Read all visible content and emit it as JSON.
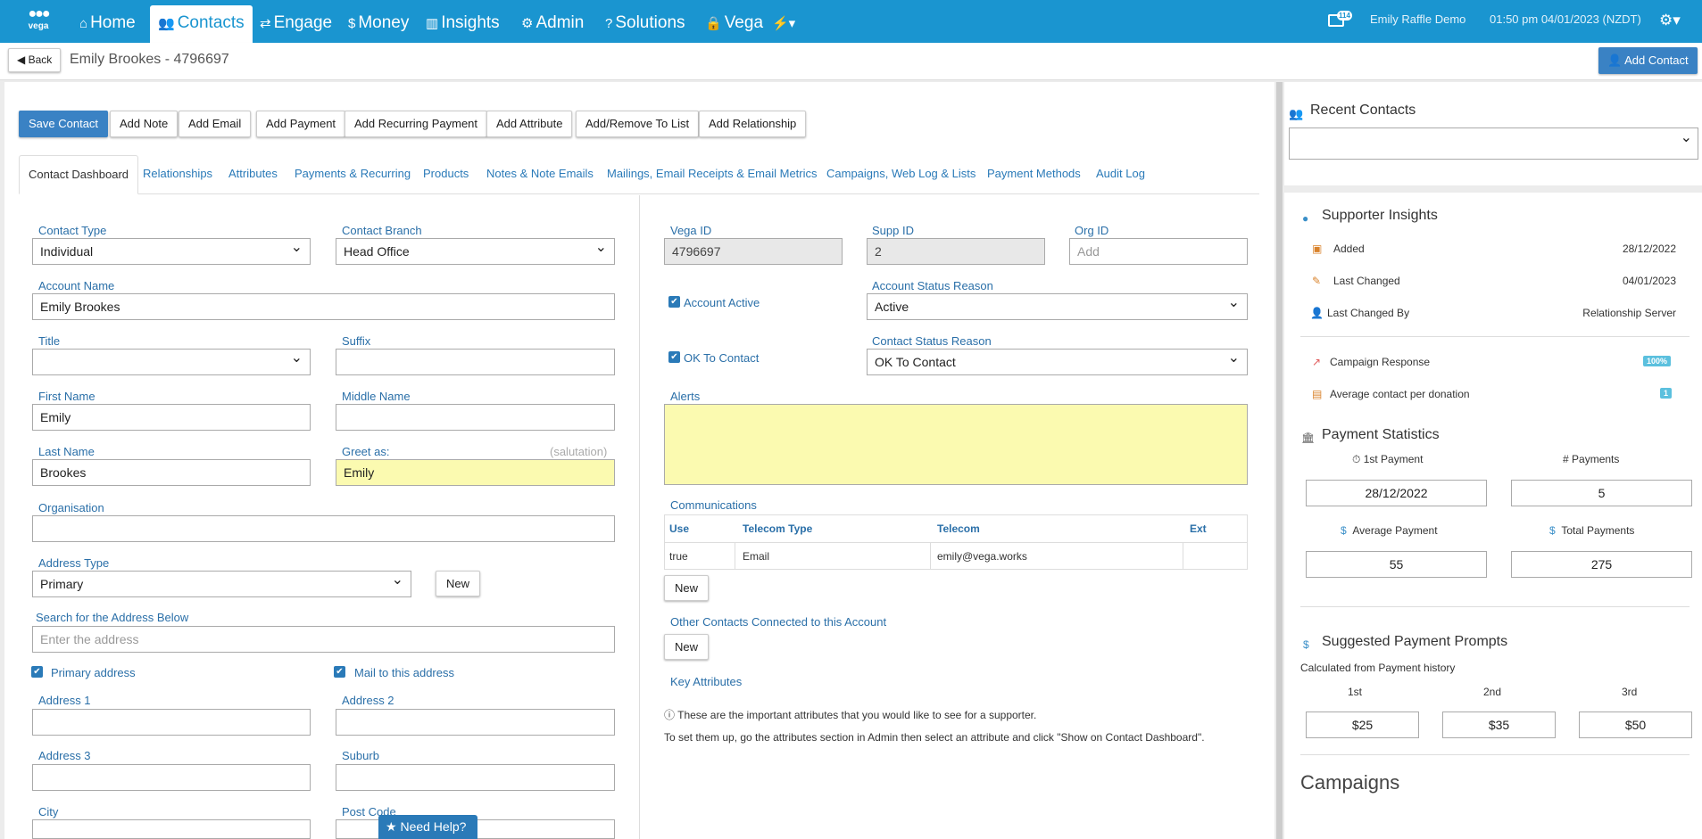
{
  "nav": {
    "logo_text": "vega",
    "items": [
      {
        "icon": "⌂",
        "label": "Home"
      },
      {
        "icon": "👥",
        "label": "Contacts"
      },
      {
        "icon": "⇄",
        "label": "Engage"
      },
      {
        "icon": "$",
        "label": "Money"
      },
      {
        "icon": "▥",
        "label": "Insights"
      },
      {
        "icon": "⚙",
        "label": "Admin"
      },
      {
        "icon": "?",
        "label": "Solutions"
      },
      {
        "icon": "🔒",
        "label": "Vega"
      },
      {
        "icon": "⚡▾",
        "label": ""
      }
    ],
    "mail_count": "114",
    "user_name": "Emily Raffle Demo",
    "datetime": "01:50 pm 04/01/2023 (NZDT)",
    "gear_menu": "⚙▾"
  },
  "subheader": {
    "back_label": "Back",
    "title": "Emily Brookes - 4796697",
    "add_contact_label": "Add Contact"
  },
  "actions": {
    "save": "Save Contact",
    "add_note": "Add Note",
    "add_email": "Add Email",
    "add_payment": "Add Payment",
    "add_recurring": "Add Recurring Payment",
    "add_attribute": "Add Attribute",
    "add_remove_list": "Add/Remove To List",
    "add_relationship": "Add Relationship"
  },
  "tabs": [
    "Contact Dashboard",
    "Relationships",
    "Attributes",
    "Payments & Recurring",
    "Products",
    "Notes & Note Emails",
    "Mailings, Email Receipts & Email Metrics",
    "Campaigns, Web Log & Lists",
    "Payment Methods",
    "Audit Log"
  ],
  "form": {
    "contact_type_label": "Contact Type",
    "contact_type_value": "Individual",
    "contact_branch_label": "Contact Branch",
    "contact_branch_value": "Head Office",
    "account_name_label": "Account Name",
    "account_name_value": "Emily Brookes",
    "title_label": "Title",
    "title_value": "",
    "suffix_label": "Suffix",
    "suffix_value": "",
    "first_name_label": "First Name",
    "first_name_value": "Emily",
    "middle_name_label": "Middle Name",
    "middle_name_value": "",
    "last_name_label": "Last Name",
    "last_name_value": "Brookes",
    "greet_as_label": "Greet as:",
    "greet_as_hint": "(salutation)",
    "greet_as_value": "Emily",
    "organisation_label": "Organisation",
    "organisation_value": "",
    "address_type_label": "Address Type",
    "address_type_value": "Primary",
    "address_new_label": "New",
    "search_address_label": "Search for the Address Below",
    "search_address_placeholder": "Enter the address",
    "primary_address_label": "Primary address",
    "mail_to_label": "Mail to this address",
    "address1_label": "Address 1",
    "address2_label": "Address 2",
    "address3_label": "Address 3",
    "suburb_label": "Suburb",
    "city_label": "City",
    "postcode_label": "Post Code"
  },
  "ids": {
    "vega_id_label": "Vega ID",
    "vega_id_value": "4796697",
    "supp_id_label": "Supp ID",
    "supp_id_value": "2",
    "org_id_label": "Org ID",
    "org_id_placeholder": "Add",
    "account_active_label": "Account Active",
    "account_status_label": "Account Status Reason",
    "account_status_value": "Active",
    "ok_to_contact_label": "OK To Contact",
    "contact_status_label": "Contact Status Reason",
    "contact_status_value": "OK To Contact",
    "alerts_label": "Alerts"
  },
  "communications": {
    "title": "Communications",
    "headers": [
      "Use",
      "Telecom Type",
      "Telecom",
      "Ext"
    ],
    "rows": [
      [
        "true",
        "Email",
        "emily@vega.works",
        ""
      ]
    ],
    "new_label": "New",
    "other_contacts_label": "Other Contacts Connected to this Account",
    "other_new_label": "New",
    "key_attributes_label": "Key Attributes",
    "info_line1": "These are the important attributes that you would like to see for a supporter.",
    "info_line2": "To set them up, go the attributes section in Admin then select an attribute and click \"Show on Contact Dashboard\"."
  },
  "need_help": "Need Help?",
  "right": {
    "recent_contacts_title": "Recent Contacts",
    "insights_title": "Supporter Insights",
    "added_label": "Added",
    "added_value": "28/12/2022",
    "last_changed_label": "Last Changed",
    "last_changed_value": "04/01/2023",
    "last_changed_by_label": "Last Changed By",
    "last_changed_by_value": "Relationship Server",
    "campaign_response_label": "Campaign Response",
    "campaign_response_value": "100%",
    "avg_contact_label": "Average contact per donation",
    "avg_contact_value": "1",
    "payment_stats_title": "Payment Statistics",
    "first_payment_label": "1st Payment",
    "first_payment_value": "28/12/2022",
    "num_payments_label": "Payments",
    "num_payments_value": "5",
    "avg_payment_label": "Average Payment",
    "avg_payment_value": "55",
    "total_payments_label": "Total Payments",
    "total_payments_value": "275",
    "suggested_title": "Suggested Payment Prompts",
    "suggested_subtitle": "Calculated from Payment history",
    "prompt_labels": [
      "1st",
      "2nd",
      "3rd"
    ],
    "prompt_values": [
      "$25",
      "$35",
      "$50"
    ],
    "campaigns_title": "Campaigns"
  }
}
